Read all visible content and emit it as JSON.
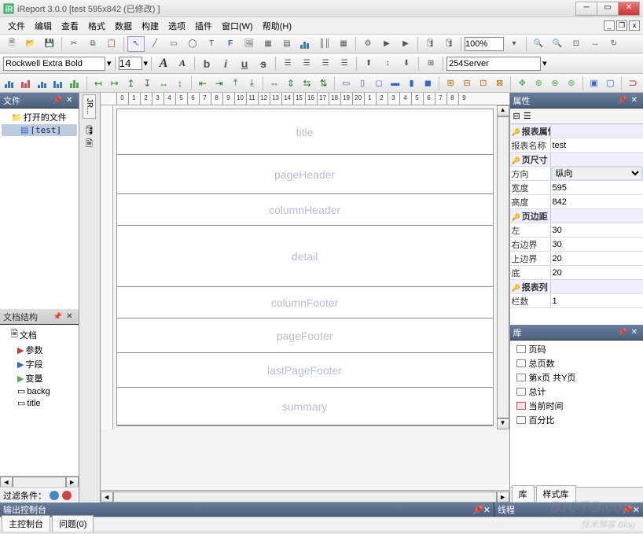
{
  "window": {
    "title": "iReport 3.0.0  [test 595x842 (已修改) ]"
  },
  "menu": {
    "file": "文件",
    "edit": "编辑",
    "view": "查看",
    "format": "格式",
    "data": "数据",
    "build": "构建",
    "options": "选项",
    "plugin": "插件",
    "window": "窗口(W)",
    "help": "帮助(H)"
  },
  "toolbar2": {
    "font": "Rockwell Extra Bold",
    "size": "14",
    "zoom": "100%",
    "server": "254Server"
  },
  "left": {
    "files_title": "文件",
    "open_files_label": "打开的文件",
    "open_file": "[test]",
    "docstruct_title": "文档结构",
    "doc_label": "文档",
    "tree": {
      "params": "参数",
      "fields": "字段",
      "vars": "变量",
      "backg": "backg",
      "title": "title"
    },
    "filter_label": "过滤条件：",
    "side_tab": "JR..."
  },
  "bands": {
    "title": "title",
    "pageHeader": "pageHeader",
    "columnHeader": "columnHeader",
    "detail": "detail",
    "columnFooter": "columnFooter",
    "pageFooter": "pageFooter",
    "lastPageFooter": "lastPageFooter",
    "summary": "summary"
  },
  "ruler": [
    "0",
    "1",
    "2",
    "3",
    "4",
    "5",
    "6",
    "7",
    "8",
    "9",
    "10",
    "11",
    "12",
    "13",
    "14",
    "15",
    "16",
    "17",
    "18",
    "19",
    "20",
    "1",
    "2",
    "3",
    "4",
    "5",
    "6",
    "7",
    "8",
    "9"
  ],
  "props": {
    "title": "属性",
    "group_report": "报表属性",
    "name_k": "报表名称",
    "name_v": "test",
    "group_size": "页尺寸",
    "dir_k": "方向",
    "dir_v": "纵向",
    "w_k": "宽度",
    "w_v": "595",
    "h_k": "高度",
    "h_v": "842",
    "group_margin": "页边距",
    "l_k": "左",
    "l_v": "30",
    "r_k": "右边界",
    "r_v": "30",
    "t_k": "上边界",
    "t_v": "20",
    "b_k": "底",
    "b_v": "20",
    "group_cols": "报表列",
    "cols_k": "栏数",
    "cols_v": "1"
  },
  "lib": {
    "title": "库",
    "page_no": "页码",
    "total": "总页数",
    "page_of": "第x页 共Y页",
    "sum": "总计",
    "now": "当前时间",
    "pct": "百分比",
    "tab_lib": "库",
    "tab_style": "样式库"
  },
  "bottom": {
    "output": "输出控制台",
    "thread": "线程",
    "main": "主控制台",
    "problems": "问题(0)"
  },
  "watermark": {
    "big": "51CTO.com",
    "sub": "技术博客  Blog"
  }
}
